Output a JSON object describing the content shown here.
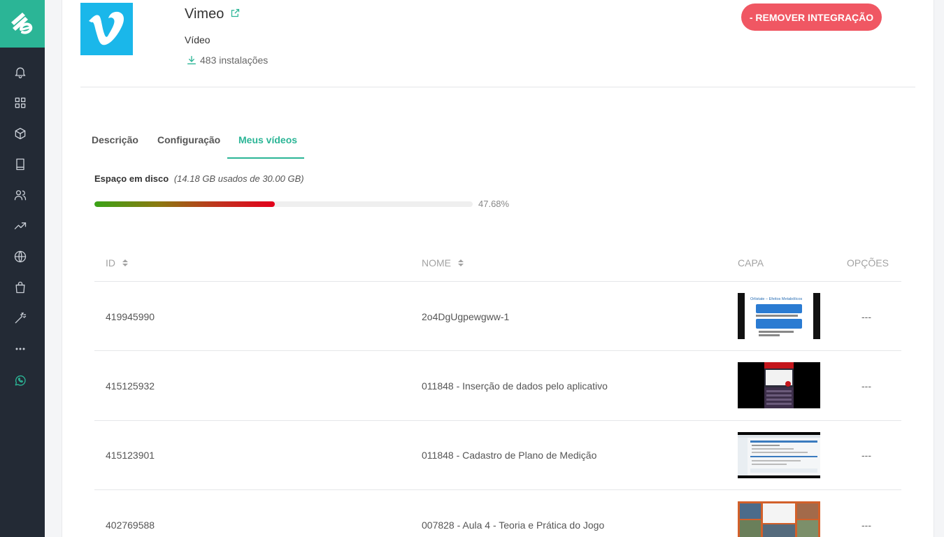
{
  "app": {
    "title": "Vimeo",
    "category": "Vídeo",
    "installs": "483 instalações",
    "remove_label": "- REMOVER INTEGRAÇÃO",
    "brand_color": "#1ab7ea"
  },
  "tabs": [
    {
      "label": "Descrição"
    },
    {
      "label": "Configuração"
    },
    {
      "label": "Meus vídeos",
      "active": true
    }
  ],
  "disk": {
    "label": "Espaço em disco",
    "usage": "(14.18 GB usados de 30.00 GB)",
    "percent_text": "47.68%",
    "percent": 47.68
  },
  "table": {
    "headers": {
      "id": "ID",
      "name": "NOME",
      "cover": "CAPA",
      "options": "OPÇÕES"
    },
    "rows": [
      {
        "id": "419945990",
        "name": "2o4DgUgpewgww-1",
        "options": "---",
        "thumb": {
          "title": "Orlistate – Efeitos Metabólicos"
        }
      },
      {
        "id": "415125932",
        "name": "011848 - Inserção de dados pelo aplicativo",
        "options": "---"
      },
      {
        "id": "415123901",
        "name": "011848 - Cadastro de Plano de Medição",
        "options": "---"
      },
      {
        "id": "402769588",
        "name": "007828 - Aula 4 - Teoria e Prática do Jogo",
        "options": "---"
      }
    ]
  },
  "colors": {
    "accent": "#2bb596",
    "danger": "#f05763",
    "sidebar": "#232a35"
  }
}
